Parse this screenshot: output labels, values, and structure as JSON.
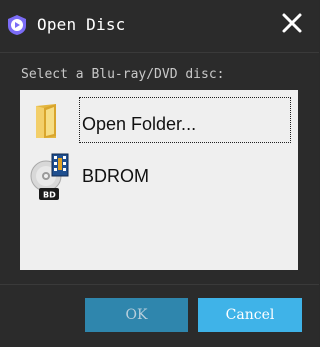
{
  "window": {
    "title": "Open Disc",
    "app_icon": "play-shield-icon",
    "close_icon": "close-icon"
  },
  "prompt": "Select a Blu-ray/DVD disc:",
  "disc_list": {
    "items": [
      {
        "label": "Open Folder...",
        "icon": "folder-icon",
        "focused": true
      },
      {
        "label": "BDROM",
        "icon": "bd-disc-icon",
        "focused": false
      }
    ]
  },
  "buttons": {
    "ok_label": "OK",
    "ok_enabled": false,
    "cancel_label": "Cancel"
  },
  "colors": {
    "background": "#2b2b2b",
    "accent": "#3fb3e8",
    "accent_disabled": "#2f86ad",
    "list_background": "#efefef",
    "app_icon": "#7b6cf6"
  }
}
